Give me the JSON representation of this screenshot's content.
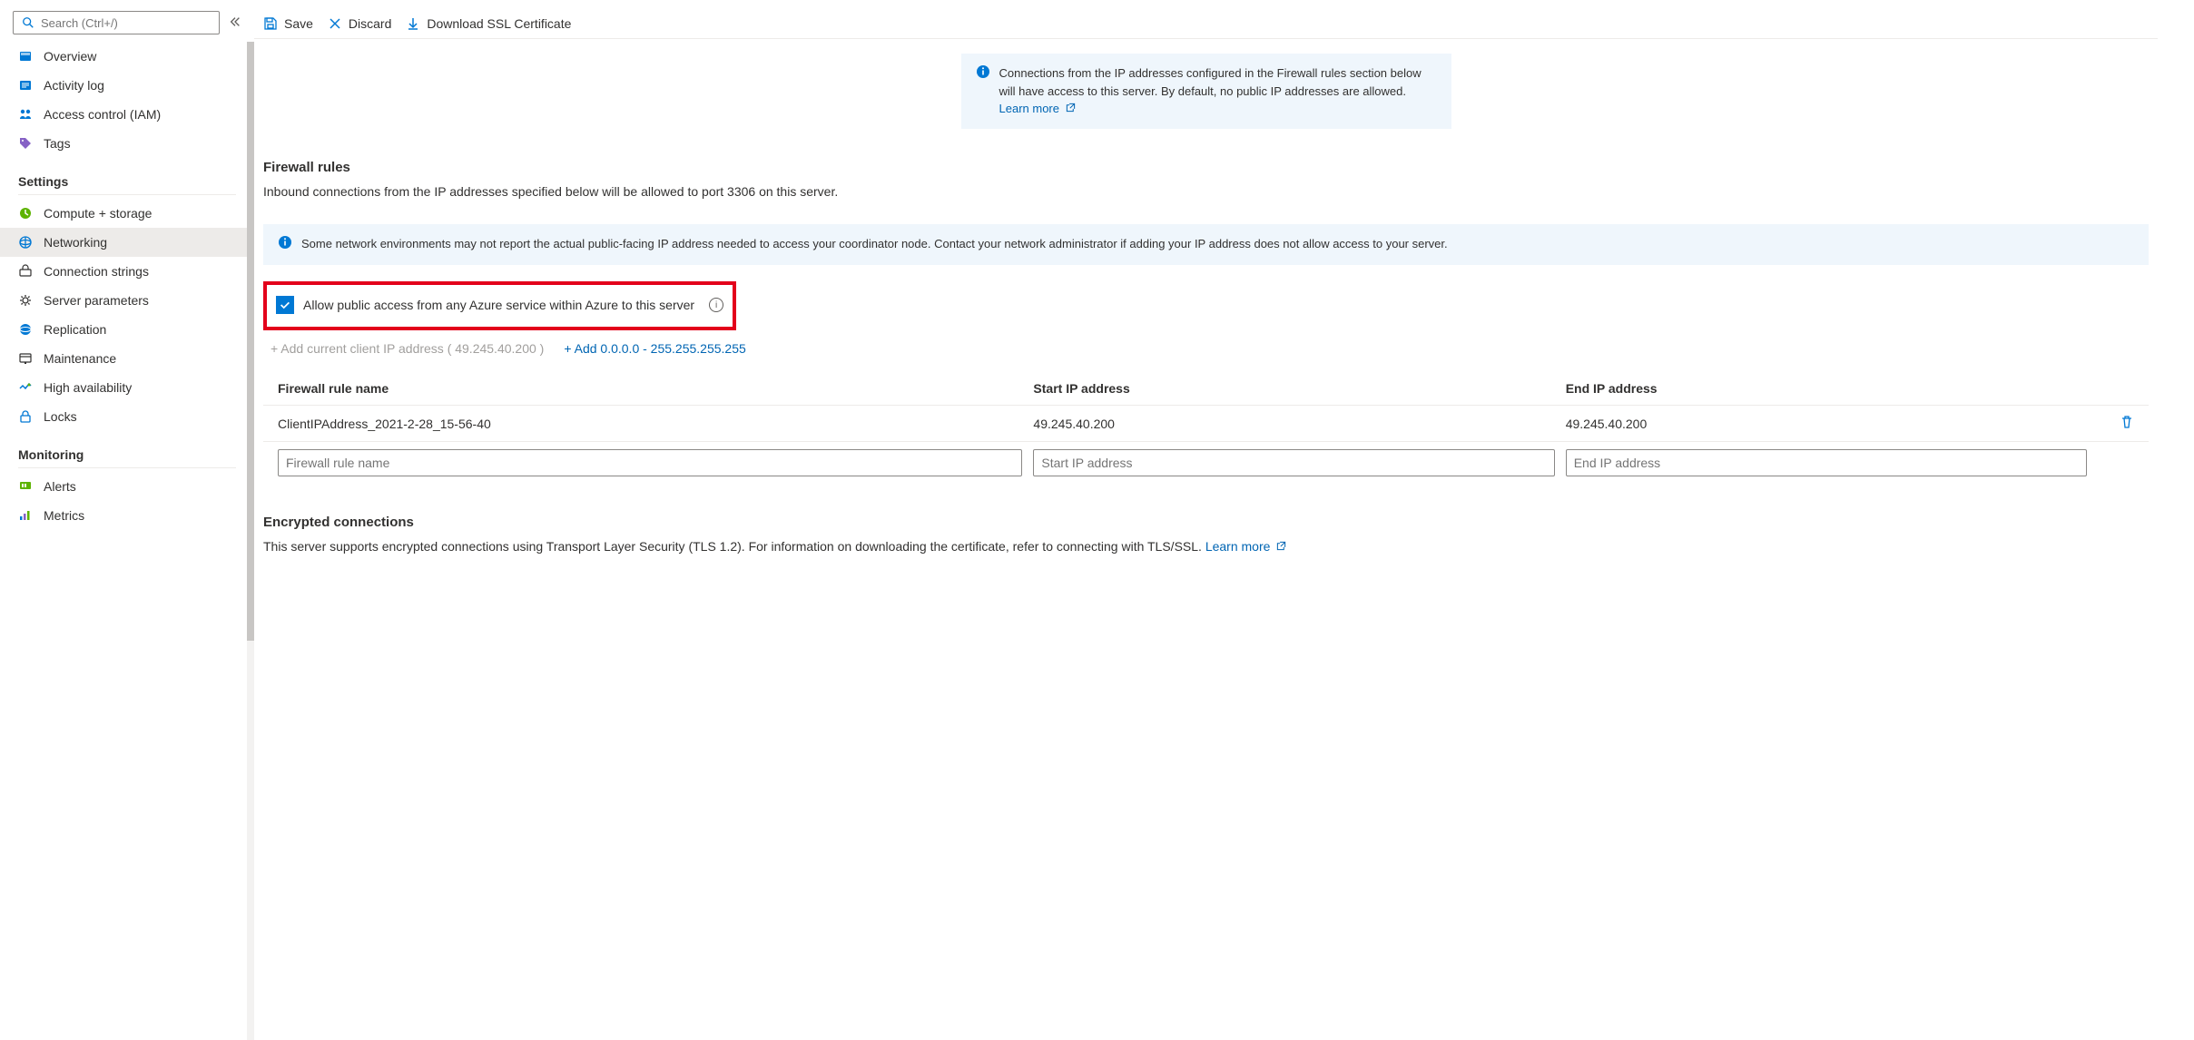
{
  "search": {
    "placeholder": "Search (Ctrl+/)"
  },
  "sidebar": {
    "top": [
      {
        "label": "Overview",
        "icon": "overview"
      },
      {
        "label": "Activity log",
        "icon": "activity"
      },
      {
        "label": "Access control (IAM)",
        "icon": "iam"
      },
      {
        "label": "Tags",
        "icon": "tags"
      }
    ],
    "sections": [
      {
        "title": "Settings",
        "items": [
          {
            "label": "Compute + storage",
            "icon": "compute"
          },
          {
            "label": "Networking",
            "icon": "networking",
            "active": true
          },
          {
            "label": "Connection strings",
            "icon": "connstr"
          },
          {
            "label": "Server parameters",
            "icon": "params"
          },
          {
            "label": "Replication",
            "icon": "replication"
          },
          {
            "label": "Maintenance",
            "icon": "maintenance"
          },
          {
            "label": "High availability",
            "icon": "ha"
          },
          {
            "label": "Locks",
            "icon": "locks"
          }
        ]
      },
      {
        "title": "Monitoring",
        "items": [
          {
            "label": "Alerts",
            "icon": "alerts"
          },
          {
            "label": "Metrics",
            "icon": "metrics"
          }
        ]
      }
    ]
  },
  "toolbar": {
    "save": "Save",
    "discard": "Discard",
    "download": "Download SSL Certificate"
  },
  "info1": {
    "text": "Connections from the IP addresses configured in the Firewall rules section below will have access to this server. By default, no public IP addresses are allowed. ",
    "learn": "Learn more"
  },
  "firewall": {
    "heading": "Firewall rules",
    "sub": "Inbound connections from the IP addresses specified below will be allowed to port 3306 on this server.",
    "info2": "Some network environments may not report the actual public-facing IP address needed to access your coordinator node. Contact your network administrator if adding your IP address does not allow access to your server.",
    "checkbox_label": "Allow public access from any Azure service within Azure to this server",
    "add_client": "+ Add current client IP address ( 49.245.40.200 )",
    "add_any": "+ Add 0.0.0.0 - 255.255.255.255",
    "cols": {
      "name": "Firewall rule name",
      "start": "Start IP address",
      "end": "End IP address"
    },
    "rows": [
      {
        "name": "ClientIPAddress_2021-2-28_15-56-40",
        "start": "49.245.40.200",
        "end": "49.245.40.200"
      }
    ],
    "placeholders": {
      "name": "Firewall rule name",
      "start": "Start IP address",
      "end": "End IP address"
    }
  },
  "encrypted": {
    "heading": "Encrypted connections",
    "text": "This server supports encrypted connections using Transport Layer Security (TLS 1.2). For information on downloading the certificate, refer to connecting with TLS/SSL. ",
    "learn": "Learn more"
  }
}
